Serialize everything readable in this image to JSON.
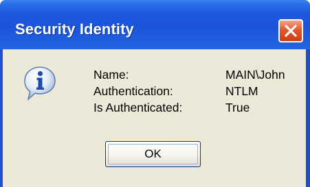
{
  "dialog": {
    "title": "Security Identity",
    "close_icon": "close-icon",
    "message_icon": "info-icon",
    "fields": [
      {
        "label": "Name:",
        "value": "MAIN\\John"
      },
      {
        "label": "Authentication:",
        "value": "NTLM"
      },
      {
        "label": "Is Authenticated:",
        "value": "True"
      }
    ],
    "ok_label": "OK"
  },
  "colors": {
    "titlebar": "#1f59dd",
    "close_button": "#e2572e",
    "client_background": "#ece9d8"
  }
}
